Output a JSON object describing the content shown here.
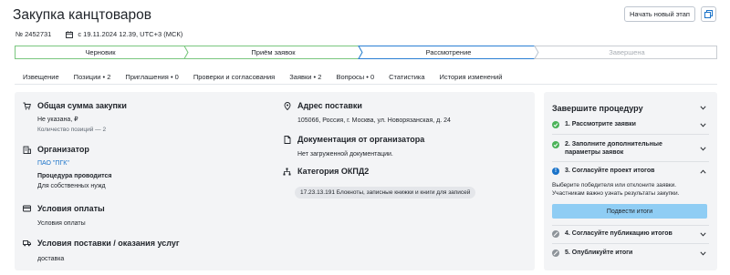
{
  "header": {
    "title": "Закупка канцтоваров",
    "new_stage_label": "Начать новый этап",
    "number": "№ 2452731",
    "date": "с 19.11.2024 12.39, UTC+3 (МСК)"
  },
  "stepper": {
    "steps": [
      {
        "label": "Черновик",
        "state": "done"
      },
      {
        "label": "Приём заявок",
        "state": "done"
      },
      {
        "label": "Рассмотрение",
        "state": "current"
      },
      {
        "label": "Завершена",
        "state": "pending"
      }
    ],
    "colors": {
      "done": "#7ac77f",
      "current": "#2a7fd4",
      "pending": "#c9cdd2"
    }
  },
  "tabs": [
    "Извещение",
    "Позиции • 2",
    "Приглашения • 0",
    "Проверки и согласования",
    "Заявки • 2",
    "Вопросы • 0",
    "Статистика",
    "История изменений"
  ],
  "left": {
    "total": {
      "title": "Общая сумма закупки",
      "value": "Не указана, ₽",
      "positions": "Количество позиций — 2"
    },
    "organizer": {
      "title": "Организатор",
      "name": "ПАО \"ПГК\"",
      "procedure_label": "Процедура проводится",
      "procedure_value": "Для собственных нужд"
    },
    "payment": {
      "title": "Условия оплаты",
      "value": "Условия оплаты"
    },
    "delivery_terms": {
      "title": "Условия поставки / оказания услуг",
      "value": "доставка"
    },
    "address": {
      "title": "Адрес поставки",
      "value": "105066, Россия, г. Москва, ул. Новорязанская, д. 24"
    },
    "docs": {
      "title": "Документация от организатора",
      "value": "Нет загруженной документации."
    },
    "okpd": {
      "title": "Категория ОКПД2",
      "value": "17.23.13.191 Блокноты, записные книжки и книги для записей"
    }
  },
  "right": {
    "title": "Завершите процедуру",
    "items": [
      {
        "label": "1. Рассмотрите заявки",
        "status": "done"
      },
      {
        "label": "2. Заполните дополнительные параметры заявок",
        "status": "done"
      },
      {
        "label": "3. Согласуйте проект итогов",
        "status": "active"
      },
      {
        "label": "4. Согласуйте публикацию итогов",
        "status": "locked"
      },
      {
        "label": "5. Опубликуйте итоги",
        "status": "locked"
      }
    ],
    "desc_line1": "Выберите победителя или отклоните заявки.",
    "desc_line2": "Участникам важно узнать результаты закупки.",
    "button_label": "Подвести итоги",
    "colors": {
      "done": "#4cb35a",
      "active": "#1a73c9",
      "locked": "#8e949a",
      "button": "#8fcdf4"
    }
  }
}
